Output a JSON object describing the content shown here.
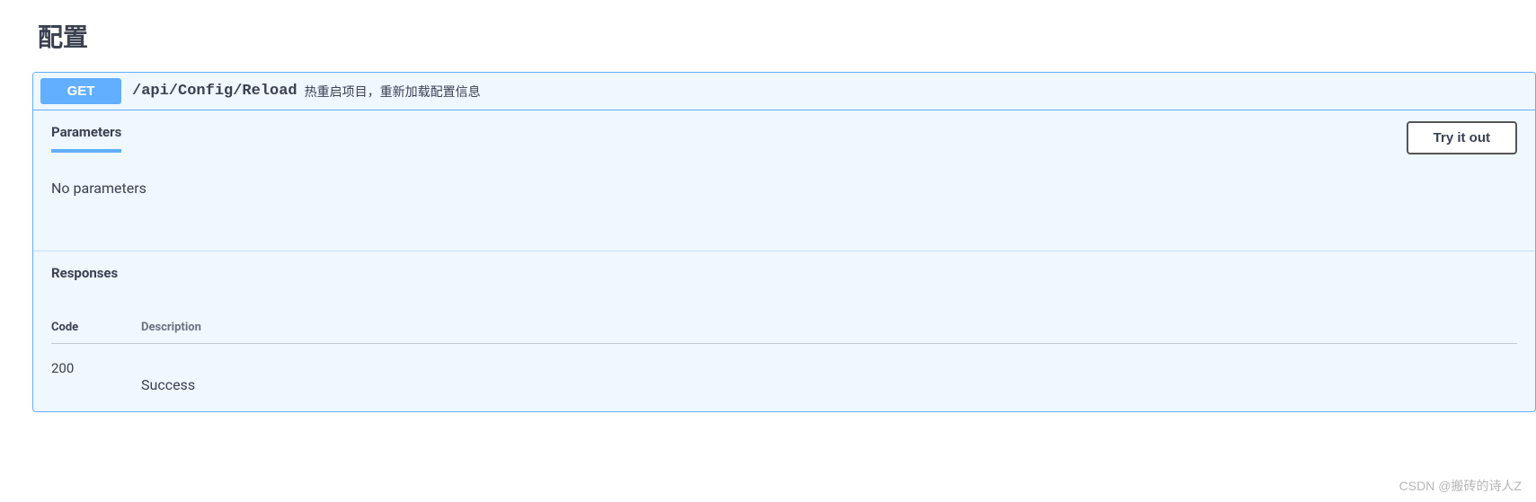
{
  "section": {
    "title": "配置"
  },
  "endpoint": {
    "method": "GET",
    "path": "/api/Config/Reload",
    "description": "热重启项目，重新加载配置信息"
  },
  "parameters": {
    "tab_label": "Parameters",
    "try_button": "Try it out",
    "empty_text": "No parameters"
  },
  "responses": {
    "title": "Responses",
    "headers": {
      "code": "Code",
      "description": "Description"
    },
    "rows": [
      {
        "code": "200",
        "description": "Success"
      }
    ]
  },
  "watermark": "CSDN @搬砖的诗人Z"
}
